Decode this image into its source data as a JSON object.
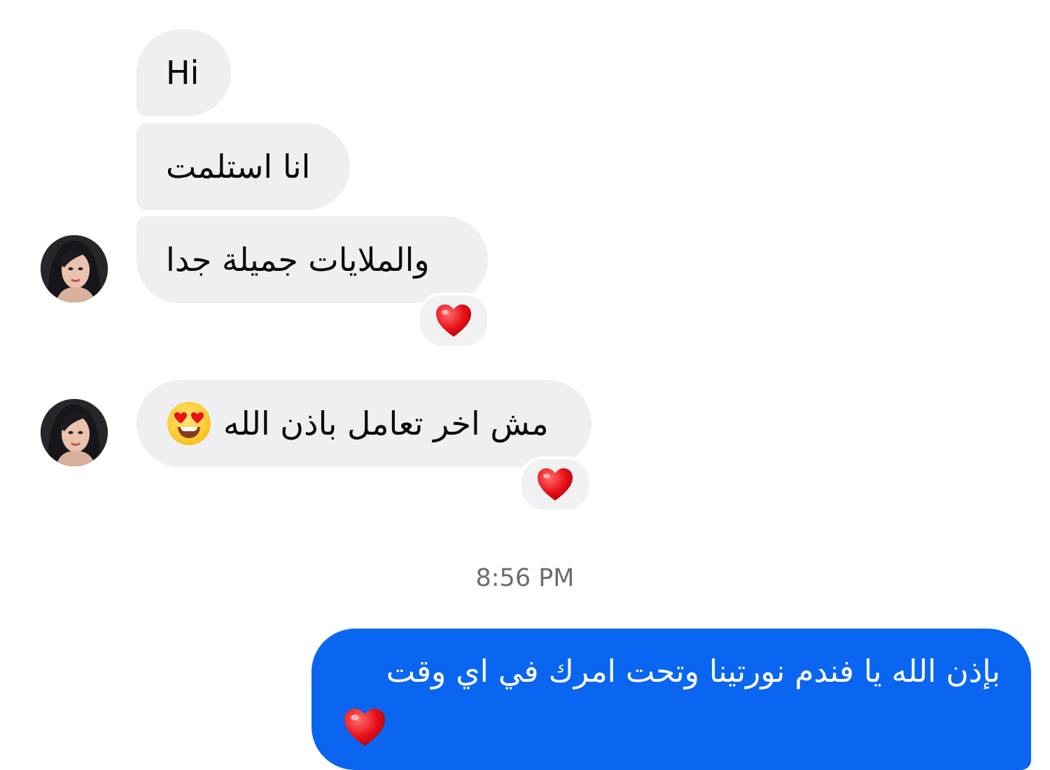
{
  "conversation": {
    "incoming": [
      {
        "text": "Hi"
      },
      {
        "text": "انا استلمت"
      },
      {
        "text": "والملايات جميلة جدا",
        "reaction": "red-heart"
      },
      {
        "text": "مش اخر تعامل باذن الله",
        "emoji": "heart-eyes-face",
        "reaction": "red-heart"
      }
    ],
    "timestamp": "8:56 PM",
    "outgoing": [
      {
        "text": "بإذن الله يا فندم نورتينا وتحت امرك في اي وقت",
        "emoji": "red-heart"
      }
    ]
  },
  "colors": {
    "incoming_bubble": "#efeff2",
    "outgoing_bubble": "#0a66f0",
    "heart": "#e8121a",
    "timestamp_text": "#6b6b70"
  }
}
